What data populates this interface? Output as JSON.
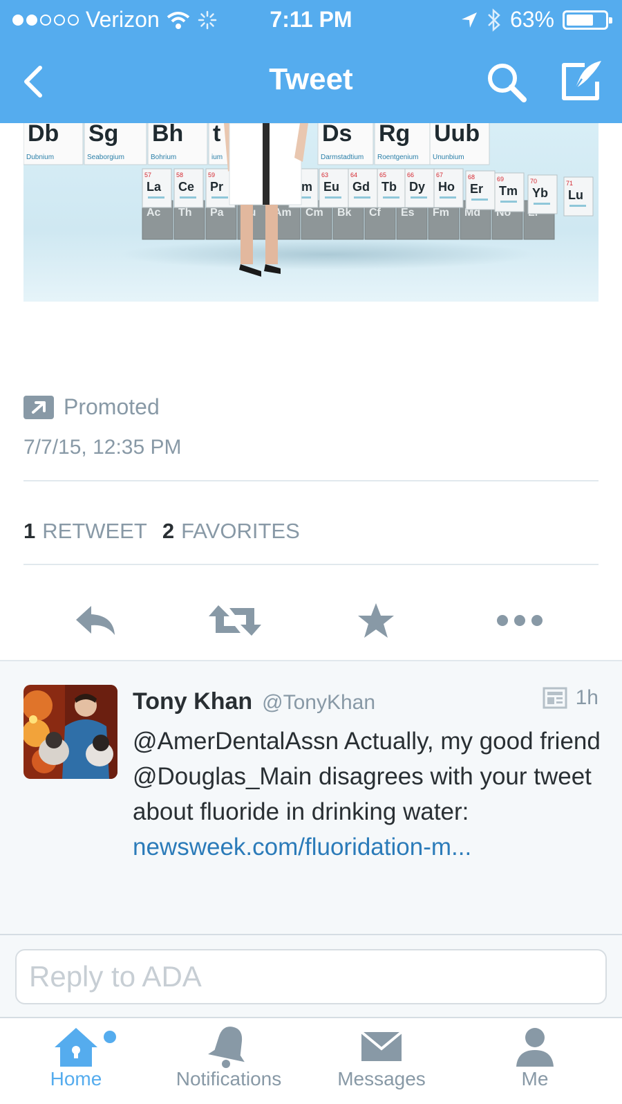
{
  "status_bar": {
    "carrier": "Verizon",
    "time": "7:11 PM",
    "battery": "63%",
    "battery_level": 0.63
  },
  "nav": {
    "title": "Tweet"
  },
  "tweet": {
    "promoted_label": "Promoted",
    "datetime": "7/7/15, 12:35 PM",
    "retweet_count": "1",
    "retweet_label": "RETWEET",
    "favorite_count": "2",
    "favorite_label": "FAVORITES",
    "media_tiles_top": [
      "Db",
      "Sg",
      "Bh",
      "t",
      "Ds",
      "Rg",
      "Uub"
    ],
    "media_subs_top": [
      "Dubnium",
      "Seaborgium",
      "Bohrium",
      "ium",
      "Darmstadtium",
      "Roentgenium",
      "Ununbium"
    ],
    "media_tiles_mid": [
      "La",
      "Ce",
      "Pr",
      "Sm",
      "Eu",
      "Gd",
      "Tb",
      "Dy",
      "Ho",
      "Er",
      "Tm",
      "Yb",
      "Lu"
    ],
    "media_nums_mid": [
      "57",
      "58",
      "59",
      "62",
      "63",
      "64",
      "65",
      "66",
      "67",
      "68",
      "69",
      "70",
      "71"
    ],
    "media_tiles_low": [
      "Ac",
      "Th",
      "Pa",
      "Pu",
      "Am",
      "Cm",
      "Bk",
      "Cf",
      "Es",
      "Fm",
      "Md",
      "No",
      "Lr"
    ]
  },
  "reply_tweet": {
    "name": "Tony Khan",
    "handle": "@TonyKhan",
    "age": "1h",
    "text": "@AmerDentalAssn Actually, my good friend @Douglas_Main disagrees with your tweet about fluoride in drinking water: ",
    "link": "newsweek.com/fluoridation-m..."
  },
  "reply_box": {
    "placeholder": "Reply to ADA"
  },
  "tabs": [
    {
      "label": "Home"
    },
    {
      "label": "Notifications"
    },
    {
      "label": "Messages"
    },
    {
      "label": "Me"
    }
  ],
  "colors": {
    "brand": "#55acee",
    "link": "#2b7bb9",
    "muted": "#8899a6"
  }
}
